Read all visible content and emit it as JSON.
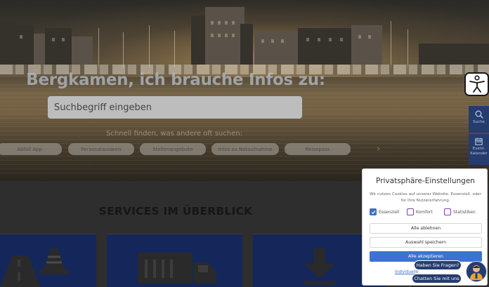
{
  "hero": {
    "title": "Bergkamen, ich brauche Infos zu:",
    "search_placeholder": "Suchbegriff eingeben",
    "quick_label": "Schnell finden, was andere oft suchen:",
    "chips": [
      "Abfall App",
      "Personalausweis",
      "Stellenangebote",
      "Infos zu Notaufnahme",
      "Reisepass"
    ]
  },
  "side_tabs": {
    "search_label": "Suche",
    "calendar_label": "Event-Kalender"
  },
  "services": {
    "title": "SERVICES IM ÜBERBLICK",
    "cards": [
      "road-cone-icon",
      "truck-icon",
      "download-icon"
    ]
  },
  "cookie_dialog": {
    "title": "Privatsphäre-Einstellungen",
    "text": "Wir nutzen Cookies auf unserer Website. Essenziell, oder für Ihre Nutzererfahrung.",
    "checkboxes": [
      {
        "label": "Essenziell",
        "checked": true
      },
      {
        "label": "Komfort",
        "checked": false
      },
      {
        "label": "Statistiken",
        "checked": false
      }
    ],
    "reject_label": "Alle ablehnen",
    "save_label": "Auswahl speichern",
    "accept_label": "Alle akzeptieren",
    "link_label": "Individuelle"
  },
  "chat": {
    "question": "Haben Sie Fragen?",
    "cta": "Chatten Sie mit uns"
  },
  "colors": {
    "navy": "#253c6e",
    "card_blue": "#15275a",
    "accept_blue": "#3d73d0",
    "checkbox_purple": "#7b3fa8"
  }
}
